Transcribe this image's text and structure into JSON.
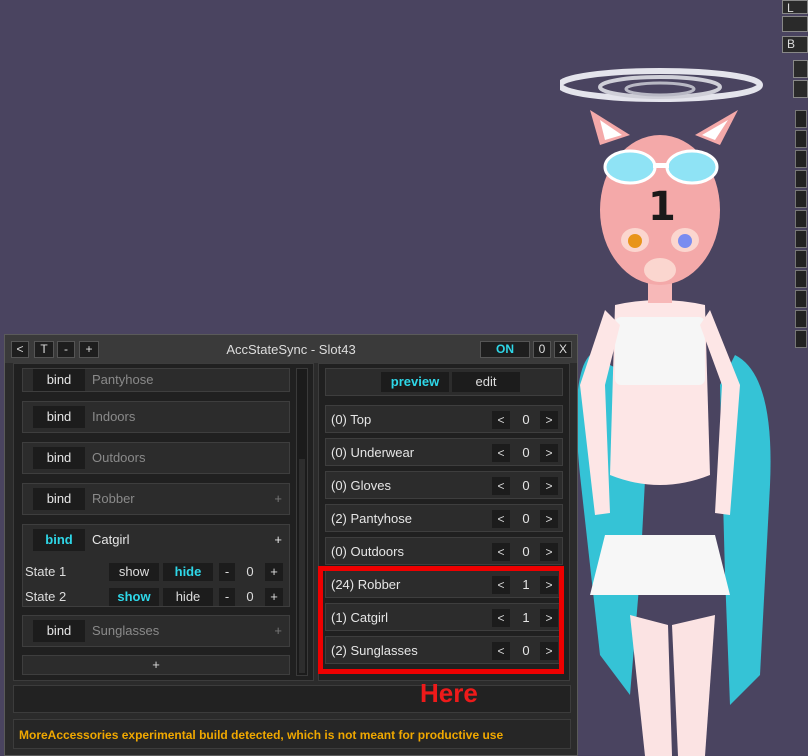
{
  "window": {
    "title": "AccStateSync - Slot43",
    "controls_left": [
      "<",
      "T",
      "-",
      "+"
    ],
    "on_label": "ON",
    "zero_label": "0",
    "close_label": "X"
  },
  "left_panel": {
    "accessories": [
      {
        "bind": "bind",
        "name": "Pantyhose",
        "plus": ""
      },
      {
        "bind": "bind",
        "name": "Indoors",
        "plus": ""
      },
      {
        "bind": "bind",
        "name": "Outdoors",
        "plus": ""
      },
      {
        "bind": "bind",
        "name": "Robber",
        "plus": "+"
      },
      {
        "bind": "bind",
        "name": "Catgirl",
        "plus": "+"
      },
      {
        "bind": "bind",
        "name": "Sunglasses",
        "plus": "+"
      }
    ],
    "states": [
      {
        "label": "State 1",
        "show": "show",
        "hide": "hide",
        "minus": "-",
        "value": "0",
        "plus": "+"
      },
      {
        "label": "State 2",
        "show": "show",
        "hide": "hide",
        "minus": "-",
        "value": "0",
        "plus": "+"
      }
    ],
    "add_label": "+"
  },
  "right_panel": {
    "tabs": [
      "preview",
      "edit"
    ],
    "slots": [
      {
        "label": "(0) Top",
        "prev": "<",
        "value": "0",
        "next": ">"
      },
      {
        "label": "(0) Underwear",
        "prev": "<",
        "value": "0",
        "next": ">"
      },
      {
        "label": "(0) Gloves",
        "prev": "<",
        "value": "0",
        "next": ">"
      },
      {
        "label": "(2) Pantyhose",
        "prev": "<",
        "value": "0",
        "next": ">"
      },
      {
        "label": "(0) Outdoors",
        "prev": "<",
        "value": "0",
        "next": ">"
      },
      {
        "label": "(24) Robber",
        "prev": "<",
        "value": "1",
        "next": ">"
      },
      {
        "label": "(1) Catgirl",
        "prev": "<",
        "value": "1",
        "next": ">"
      },
      {
        "label": "(2) Sunglasses",
        "prev": "<",
        "value": "0",
        "next": ">"
      }
    ]
  },
  "annotation": {
    "text": "Here",
    "color": "#ee1a1a"
  },
  "status": {
    "text": "MoreAccessories experimental build detected, which is not meant for productive use",
    "color": "#f0a800"
  },
  "edge_ui": {
    "buttons": [
      "L",
      "B",
      "B"
    ]
  },
  "colors": {
    "accent": "#2ed7e8",
    "background": "#4a4460"
  }
}
